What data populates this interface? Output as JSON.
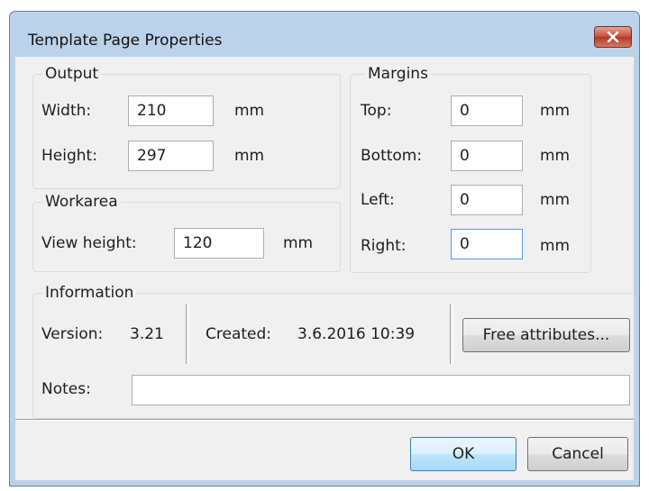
{
  "window": {
    "title": "Template Page Properties"
  },
  "output": {
    "legend": "Output",
    "width_label": "Width:",
    "width_value": "210",
    "width_unit": "mm",
    "height_label": "Height:",
    "height_value": "297",
    "height_unit": "mm"
  },
  "workarea": {
    "legend": "Workarea",
    "view_height_label": "View height:",
    "view_height_value": "120",
    "view_height_unit": "mm"
  },
  "margins": {
    "legend": "Margins",
    "top_label": "Top:",
    "top_value": "0",
    "top_unit": "mm",
    "bottom_label": "Bottom:",
    "bottom_value": "0",
    "bottom_unit": "mm",
    "left_label": "Left:",
    "left_value": "0",
    "left_unit": "mm",
    "right_label": "Right:",
    "right_value": "0",
    "right_unit": "mm"
  },
  "information": {
    "legend": "Information",
    "version_label": "Version:",
    "version_value": "3.21",
    "created_label": "Created:",
    "created_value": "3.6.2016 10:39",
    "free_attributes_label": "Free attributes...",
    "notes_label": "Notes:",
    "notes_value": ""
  },
  "buttons": {
    "ok_label": "OK",
    "cancel_label": "Cancel"
  },
  "icons": {
    "close": "close-x-icon"
  },
  "colors": {
    "titlebar": "#bcd2ea",
    "close_button": "#c5503c",
    "focus_border": "#569de5"
  }
}
